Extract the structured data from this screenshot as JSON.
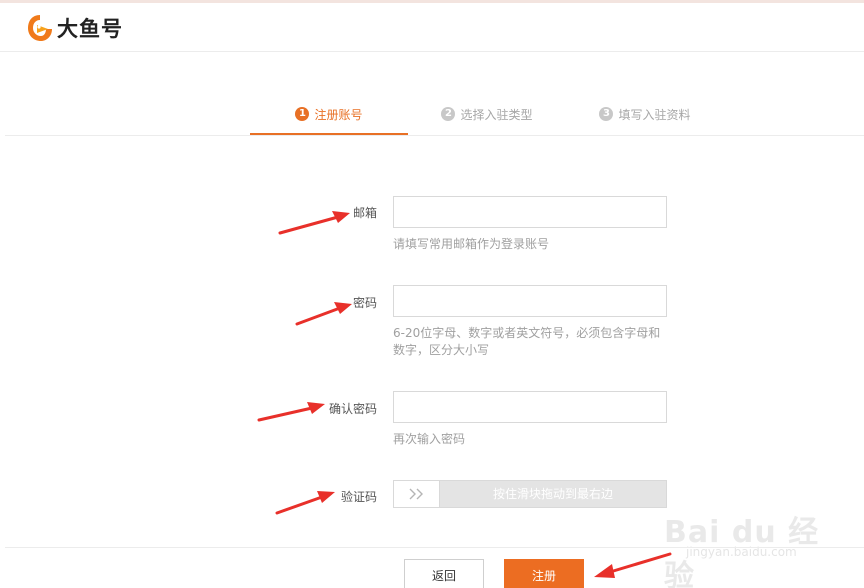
{
  "brand": {
    "name": "大鱼号",
    "accent": "#e87025",
    "logo_icon": "fish-logo-icon"
  },
  "steps": [
    {
      "num": "1",
      "label": "注册账号",
      "active": true
    },
    {
      "num": "2",
      "label": "选择入驻类型",
      "active": false
    },
    {
      "num": "3",
      "label": "填写入驻资料",
      "active": false
    }
  ],
  "form": {
    "email": {
      "label": "邮箱",
      "value": "",
      "hint": "请填写常用邮箱作为登录账号"
    },
    "password": {
      "label": "密码",
      "value": "",
      "hint": "6-20位字母、数字或者英文符号，必须包含字母和数字，区分大小写"
    },
    "confirm": {
      "label": "确认密码",
      "value": "",
      "hint": "再次输入密码"
    },
    "captcha": {
      "label": "验证码",
      "slider_text": "按住滑块拖动到最右边",
      "handle_icon": "double-chevron-right-icon"
    }
  },
  "buttons": {
    "back": "返回",
    "register": "注册"
  },
  "annotations": {
    "arrow_color": "#e8302a"
  },
  "watermark": {
    "main": "Bai du 经验",
    "sub": "jingyan.baidu.com"
  }
}
